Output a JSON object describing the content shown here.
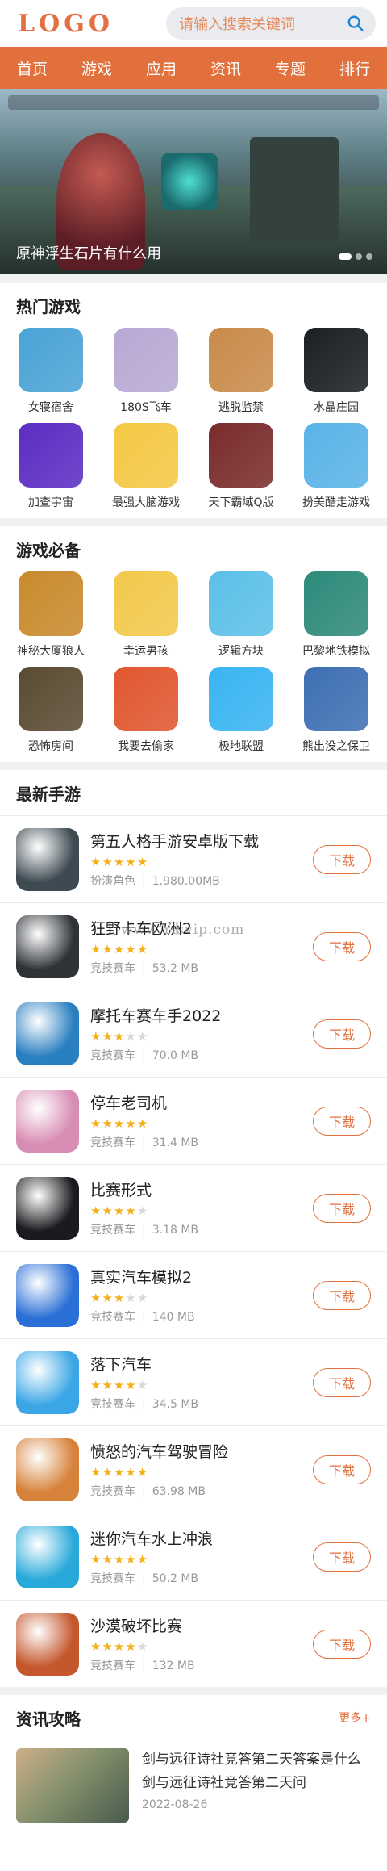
{
  "header": {
    "logo": "LOGO",
    "search_placeholder": "请输入搜索关键词"
  },
  "nav": [
    "首页",
    "游戏",
    "应用",
    "资讯",
    "专题",
    "排行"
  ],
  "banner": {
    "title": "原神浮生石片有什么用"
  },
  "hot_games": {
    "title": "热门游戏",
    "items": [
      {
        "name": "女寝宿舍",
        "color": "#4aa3d6"
      },
      {
        "name": "180S飞车",
        "color": "#b8a9d4"
      },
      {
        "name": "逃脱监禁",
        "color": "#c98b4a"
      },
      {
        "name": "水晶庄园",
        "color": "#1a1f24"
      },
      {
        "name": "加查宇宙",
        "color": "#5b2dc2"
      },
      {
        "name": "最强大脑游戏",
        "color": "#f4c844"
      },
      {
        "name": "天下霸域Q版",
        "color": "#7a2b2b"
      },
      {
        "name": "扮美酷走游戏",
        "color": "#5ab3e8"
      }
    ]
  },
  "must_games": {
    "title": "游戏必备",
    "items": [
      {
        "name": "神秘大厦狼人",
        "color": "#c98a2c"
      },
      {
        "name": "幸运男孩",
        "color": "#f2c94c"
      },
      {
        "name": "逻辑方块",
        "color": "#5cc0e8"
      },
      {
        "name": "巴黎地铁模拟",
        "color": "#2d8a7a"
      },
      {
        "name": "恐怖房间",
        "color": "#5a4a32"
      },
      {
        "name": "我要去偷家",
        "color": "#e0572f"
      },
      {
        "name": "极地联盟",
        "color": "#3ab4f2"
      },
      {
        "name": "熊出没之保卫",
        "color": "#3e6fb3"
      }
    ]
  },
  "latest": {
    "title": "最新手游",
    "download_label": "下载",
    "items": [
      {
        "name": "第五人格手游安卓版下载",
        "stars": 5,
        "category": "扮演角色",
        "size": "1,980.00MB",
        "color": "#3e4a52"
      },
      {
        "name": "狂野卡车欧洲2",
        "stars": 5,
        "category": "竞技赛车",
        "size": "53.2 MB",
        "color": "#2f3338"
      },
      {
        "name": "摩托车赛车手2022",
        "stars": 3,
        "category": "竞技赛车",
        "size": "70.0 MB",
        "color": "#2a7fc1"
      },
      {
        "name": "停车老司机",
        "stars": 5,
        "category": "竞技赛车",
        "size": "31.4 MB",
        "color": "#d88db4"
      },
      {
        "name": "比赛形式",
        "stars": 4,
        "category": "竞技赛车",
        "size": "3.18 MB",
        "color": "#1b1b1f"
      },
      {
        "name": "真实汽车模拟2",
        "stars": 3,
        "category": "竞技赛车",
        "size": "140 MB",
        "color": "#2a6fd6"
      },
      {
        "name": "落下汽车",
        "stars": 4,
        "category": "竞技赛车",
        "size": "34.5 MB",
        "color": "#3aa6e6"
      },
      {
        "name": "愤怒的汽车驾驶冒险",
        "stars": 5,
        "category": "竞技赛车",
        "size": "63.98 MB",
        "color": "#d7823a"
      },
      {
        "name": "迷你汽车水上冲浪",
        "stars": 5,
        "category": "竞技赛车",
        "size": "50.2 MB",
        "color": "#29a9d9"
      },
      {
        "name": "沙漠破坏比赛",
        "stars": 4,
        "category": "竞技赛车",
        "size": "132 MB",
        "color": "#c4572c"
      }
    ]
  },
  "watermark": "www.Yisvip.com",
  "news": {
    "title": "资讯攻略",
    "more": "更多+",
    "items": [
      {
        "title": "剑与远征诗社竞答第二天答案是什么 剑与远征诗社竞答第二天问",
        "date": "2022-08-26"
      }
    ]
  }
}
